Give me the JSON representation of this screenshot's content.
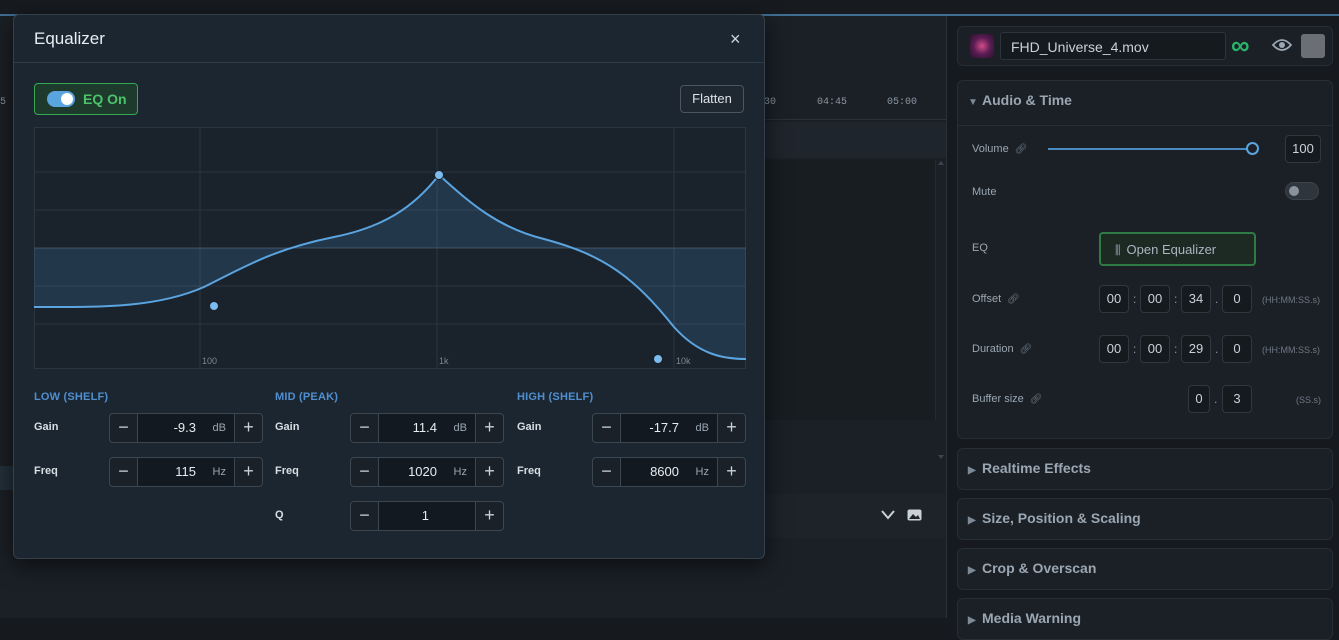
{
  "timeline": {
    "ruler_ticks": [
      "30",
      "04:45",
      "05:00"
    ],
    "left_tick": "5"
  },
  "inspector": {
    "media_name": "FHD_Universe_4.mov",
    "infinity_icon": "∞",
    "audio_section": {
      "title": "Audio & Time",
      "volume_label": "Volume",
      "volume_value": "100",
      "volume_level": 1.0,
      "mute_label": "Mute",
      "mute_on": false,
      "eq_label": "EQ",
      "open_eq_label": "Open Equalizer",
      "offset_label": "Offset",
      "offset": {
        "hh": "00",
        "mm": "00",
        "ss": "34",
        "frac": "0"
      },
      "offset_hint": "(HH:MM:SS.s)",
      "duration_label": "Duration",
      "duration": {
        "hh": "00",
        "mm": "00",
        "ss": "29",
        "frac": "0"
      },
      "duration_hint": "(HH:MM:SS.s)",
      "buffer_label": "Buffer size",
      "buffer": {
        "ss": "0",
        "frac": "3"
      },
      "buffer_hint": "(SS.s)",
      "sep_colon": ":",
      "sep_dot": "."
    },
    "collapsed_sections": [
      "Realtime Effects",
      "Size, Position & Scaling",
      "Crop & Overscan",
      "Media Warning"
    ]
  },
  "equalizer": {
    "title": "Equalizer",
    "close": "×",
    "toggle_label": "EQ On",
    "toggle_on": true,
    "flatten_label": "Flatten",
    "graph": {
      "freq_labels": [
        "100",
        "1k",
        "10k"
      ]
    },
    "bands": {
      "low": {
        "title": "LOW (SHELF)",
        "gain_label": "Gain",
        "gain": "-9.3",
        "gain_unit": "dB",
        "freq_label": "Freq",
        "freq": "115",
        "freq_unit": "Hz"
      },
      "mid": {
        "title": "MID (PEAK)",
        "gain_label": "Gain",
        "gain": "11.4",
        "gain_unit": "dB",
        "freq_label": "Freq",
        "freq": "1020",
        "freq_unit": "Hz",
        "q_label": "Q",
        "q": "1"
      },
      "high": {
        "title": "HIGH (SHELF)",
        "gain_label": "Gain",
        "gain": "-17.7",
        "gain_unit": "dB",
        "freq_label": "Freq",
        "freq": "8600",
        "freq_unit": "Hz"
      }
    },
    "stepper_minus": "−",
    "stepper_plus": "+"
  },
  "colors": {
    "accent_blue": "#5aa4e0",
    "eq_on_green": "#4cc36b",
    "panel_bg": "#1c2630"
  }
}
